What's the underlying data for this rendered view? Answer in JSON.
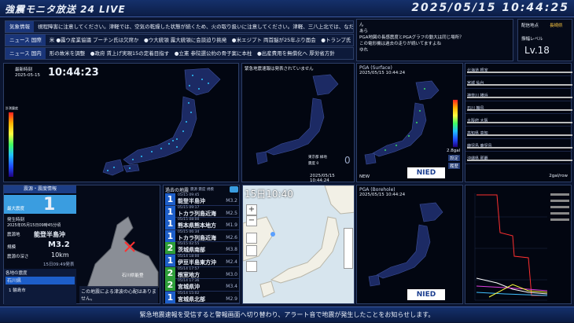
{
  "header": {
    "title": "強震モニタ放送 24 LIVE",
    "datetime": "2025/05/15 10:44:25"
  },
  "ticker1": {
    "label": "気象情報",
    "text": "視程障害に注意してください。津軽では、空気の乾燥した状態が続くため、火の取り扱いに注意してください。津軽、三八上北では、なだれに注意して"
  },
  "ticker2": {
    "label": "ニュース 国際",
    "text": "米 ●露ウ産業協議 プーチン氏は欠席か　●ウ大統領 露大統領に会談迫り挑発　●米エジプト 両首脳が25年ぶり面会　●トランプ氏"
  },
  "ticker3": {
    "label": "ニュース 国内",
    "text": "形の故米を調整　●政府 賃上げ実現15の定着目指す　●立憲 参院選公約の骨子案に本柱　●出産費用を無償化へ 厚労省方針"
  },
  "chat": {
    "lines": [
      "ん",
      "あら",
      "PGA地図の長感震度とPGAグラフの動大は同じ場所？",
      "この電形機は過去の走りが続いてますよね",
      "ゆれ"
    ]
  },
  "info": {
    "location_label": "配信地点",
    "location_value": "長崎県",
    "level_label": "振幅レベル",
    "level_value": "Lv.18"
  },
  "monitor": {
    "title": "最新時刻",
    "time_label": "2025-05-15",
    "time_value": "10:44:23",
    "scale_label": "計測震度"
  },
  "eew": {
    "title": "緊急地震速報は発表されていません",
    "footer": "2025/05/15 10:44:24",
    "legend1": "東京都 緑地",
    "legend2": "震度 0",
    "value": "0"
  },
  "pga_surface": {
    "title": "PGA (Surface)",
    "time": "2025/05/15 10:44:24",
    "logo": "NIED",
    "unit": "2.8gal",
    "label_new": "NEW",
    "button1": "設定",
    "button2": "履歴"
  },
  "pga_borehole": {
    "title": "PGA (Borehole)",
    "time": "2025/05/15 10:44:24",
    "logo": "NIED"
  },
  "waveforms": {
    "stations": [
      "北海道 根室",
      "宮城 仙台",
      "神奈川 横浜",
      "石川 輪島",
      "大阪府 大阪",
      "高知県 高知",
      "鹿児島 鹿児島",
      "沖縄県 那覇"
    ],
    "unit": "2gal/row"
  },
  "quake": {
    "title": "震源・震度情報",
    "max_label": "最大震度",
    "max_value": "1",
    "time_label": "発生時刻",
    "time_value": "2025年05月15日09時45分頃",
    "epicenter_label": "震源地",
    "epicenter_value": "能登半島沖",
    "mag_label": "規模",
    "mag_value": "M3.2",
    "depth_label": "震源の深さ",
    "depth_value": "10km",
    "updated": "15日09:49発表",
    "pref_title": "各地の震度",
    "pref1": "石川県",
    "pref2": "1 輪島市",
    "tsunami": "この地震による津波の心配はありません。",
    "map_label": "石川県能登"
  },
  "history": {
    "title": "過去の地震",
    "subtitle": "震源 震度 規模",
    "items": [
      {
        "num": "1",
        "date": "05/15 09:45",
        "name": "能登半島沖",
        "mag": "M3.2",
        "c": "b"
      },
      {
        "num": "1",
        "date": "05/15 09:17",
        "name": "トカラ列島近海",
        "mag": "M2.5",
        "c": "b"
      },
      {
        "num": "1",
        "date": "05/15 08:00",
        "name": "熊本県熊本地方",
        "mag": "M1.9",
        "c": "b"
      },
      {
        "num": "1",
        "date": "05/15 06:34",
        "name": "トカラ列島近海",
        "mag": "M2.6",
        "c": "b"
      },
      {
        "num": "2",
        "date": "05/15 02:55",
        "name": "茨城県南部",
        "mag": "M3.8",
        "c": "g"
      },
      {
        "num": "1",
        "date": "05/14 18:00",
        "name": "伊豆半島東方沖",
        "mag": "M2.4",
        "c": "b"
      },
      {
        "num": "2",
        "date": "05/14 17:57",
        "name": "根室地方",
        "mag": "M3.0",
        "c": "g"
      },
      {
        "num": "2",
        "date": "05/14 17:36",
        "name": "宮城県沖",
        "mag": "M3.4",
        "c": "g"
      },
      {
        "num": "1",
        "date": "05/14 15:02",
        "name": "宮城県北部",
        "mag": "M2.9",
        "c": "b"
      }
    ]
  },
  "radar": {
    "time": "15日10:40",
    "zoom_in": "+",
    "zoom_out": "−"
  },
  "footer": {
    "text": "緊急地震速報を受信すると警報画面へ切り替わり、アラート音で地震が発生したことをお知らせします。"
  },
  "colors": {
    "accent": "#1d5ec9",
    "green": "#2e9e3a",
    "bg": "#0b1530"
  }
}
